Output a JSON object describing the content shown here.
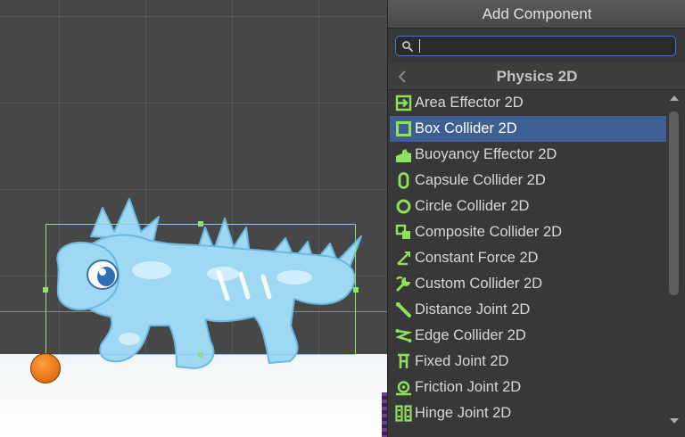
{
  "panel": {
    "title": "Add Component",
    "search": {
      "value": "",
      "placeholder": ""
    },
    "category": "Physics 2D",
    "items": [
      {
        "label": "Area Effector 2D",
        "icon": "area-effector-icon",
        "selected": false
      },
      {
        "label": "Box Collider 2D",
        "icon": "box-collider-icon",
        "selected": true
      },
      {
        "label": "Buoyancy Effector 2D",
        "icon": "buoyancy-effector-icon",
        "selected": false
      },
      {
        "label": "Capsule Collider 2D",
        "icon": "capsule-collider-icon",
        "selected": false
      },
      {
        "label": "Circle Collider 2D",
        "icon": "circle-collider-icon",
        "selected": false
      },
      {
        "label": "Composite Collider 2D",
        "icon": "composite-collider-icon",
        "selected": false
      },
      {
        "label": "Constant Force 2D",
        "icon": "constant-force-icon",
        "selected": false
      },
      {
        "label": "Custom Collider 2D",
        "icon": "custom-collider-icon",
        "selected": false
      },
      {
        "label": "Distance Joint 2D",
        "icon": "distance-joint-icon",
        "selected": false
      },
      {
        "label": "Edge Collider 2D",
        "icon": "edge-collider-icon",
        "selected": false
      },
      {
        "label": "Fixed Joint 2D",
        "icon": "fixed-joint-icon",
        "selected": false
      },
      {
        "label": "Friction Joint 2D",
        "icon": "friction-joint-icon",
        "selected": false
      },
      {
        "label": "Hinge Joint 2D",
        "icon": "hinge-joint-icon",
        "selected": false
      }
    ]
  },
  "colors": {
    "icon_green": "#8fe05a",
    "selection": "#3e5f93",
    "collider_outline": "#93e06b",
    "search_focus": "#3a79c6"
  }
}
